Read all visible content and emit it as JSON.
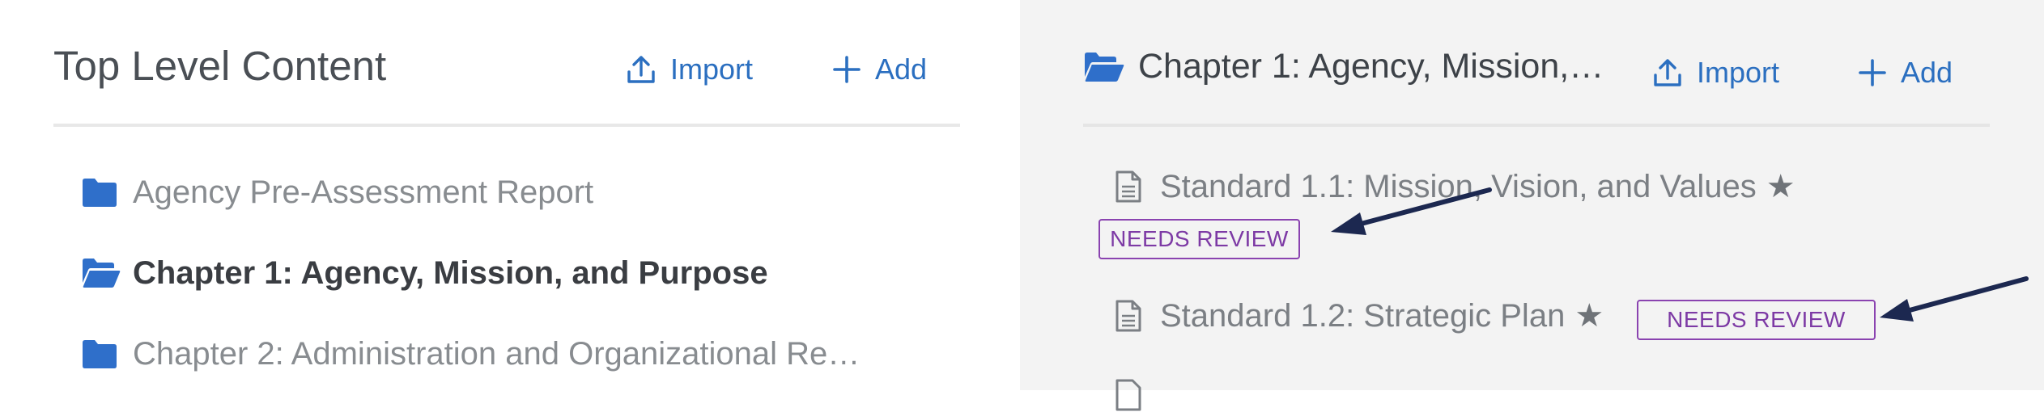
{
  "left_panel": {
    "title": "Top Level Content",
    "import_label": "Import",
    "add_label": "Add",
    "items": [
      {
        "label": "Agency Pre-Assessment Report",
        "icon": "folder-icon",
        "active": false
      },
      {
        "label": "Chapter 1: Agency, Mission, and Purpose",
        "icon": "folder-open-icon",
        "active": true
      },
      {
        "label": "Chapter 2: Administration and Organizational Re…",
        "icon": "folder-icon",
        "active": false
      }
    ]
  },
  "right_panel": {
    "title": "Chapter 1: Agency, Mission,…",
    "import_label": "Import",
    "add_label": "Add",
    "standards": [
      {
        "label": "Standard 1.1: Mission, Vision, and Values",
        "star": "★",
        "badge": "NEEDS REVIEW",
        "icon": "document-icon"
      },
      {
        "label": "Standard 1.2: Strategic Plan",
        "star": "★",
        "badge": "NEEDS REVIEW",
        "icon": "document-icon"
      }
    ]
  },
  "colors": {
    "accent": "#2b6fc0",
    "folder": "#2f6fca",
    "badge_border": "#8a43b0",
    "arrow": "#1c2850",
    "right_background": "#f3f3f3"
  }
}
